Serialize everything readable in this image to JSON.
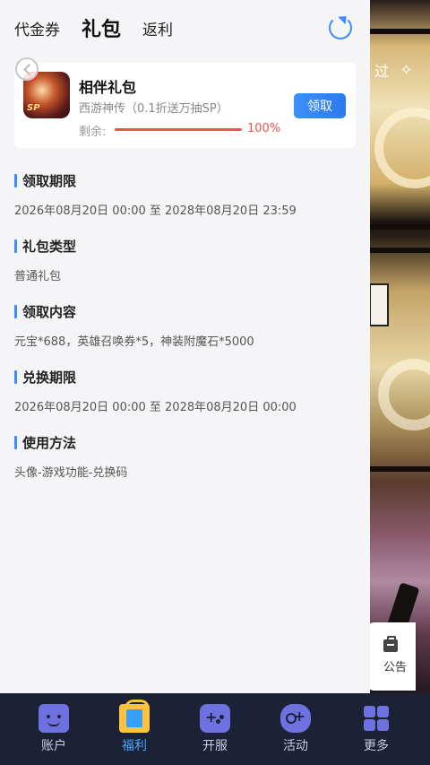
{
  "header": {
    "tabs": [
      {
        "label": "代金券"
      },
      {
        "label": "礼包"
      },
      {
        "label": "返利"
      }
    ]
  },
  "gift": {
    "title": "相伴礼包",
    "subtitle": "西游神传（0.1折送万抽SP）",
    "remain_label": "剩余:",
    "remain_percent": 100,
    "remain_percent_text": "100%",
    "claim_label": "领取"
  },
  "sections": [
    {
      "title": "领取期限",
      "body": "2026年08月20日 00:00 至 2028年08月20日 23:59"
    },
    {
      "title": "礼包类型",
      "body": "普通礼包"
    },
    {
      "title": "领取内容",
      "body": "元宝*688，英雄召唤券*5，神装附魔石*5000"
    },
    {
      "title": "兑换期限",
      "body": "2026年08月20日 00:00 至 2028年08月20日 00:00"
    },
    {
      "title": "使用方法",
      "body": "头像-游戏功能-兑换码"
    }
  ],
  "background": {
    "overlay_text": "过"
  },
  "notice": {
    "label": "公告"
  },
  "bottom_nav": [
    {
      "label": "账户",
      "icon": "account-icon"
    },
    {
      "label": "福利",
      "icon": "welfare-icon",
      "active": true
    },
    {
      "label": "开服",
      "icon": "server-icon"
    },
    {
      "label": "活动",
      "icon": "activity-icon"
    },
    {
      "label": "更多",
      "icon": "more-icon"
    }
  ],
  "colors": {
    "accent": "#3a8dfc",
    "progress": "#f05252",
    "nav_bg": "#1c2236",
    "nav_active": "#4da3ff"
  }
}
